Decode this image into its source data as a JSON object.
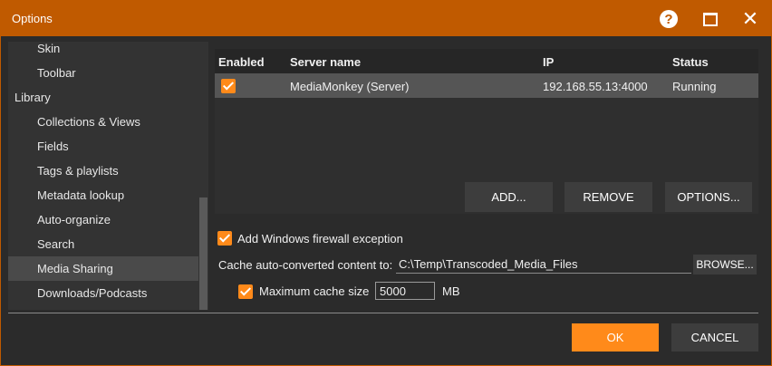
{
  "window": {
    "title": "Options"
  },
  "titlebar": {
    "help_icon": "question-circle-icon",
    "maximize_icon": "maximize-icon",
    "close_icon": "close-icon",
    "help_glyph": "?",
    "close_glyph": "✕"
  },
  "sidebar": {
    "items": [
      {
        "label": "Skin",
        "level": 1,
        "selected": false
      },
      {
        "label": "Toolbar",
        "level": 1,
        "selected": false
      },
      {
        "label": "Library",
        "level": 0,
        "selected": false
      },
      {
        "label": "Collections & Views",
        "level": 1,
        "selected": false
      },
      {
        "label": "Fields",
        "level": 1,
        "selected": false
      },
      {
        "label": "Tags & playlists",
        "level": 1,
        "selected": false
      },
      {
        "label": "Metadata lookup",
        "level": 1,
        "selected": false
      },
      {
        "label": "Auto-organize",
        "level": 1,
        "selected": false
      },
      {
        "label": "Search",
        "level": 1,
        "selected": false
      },
      {
        "label": "Media Sharing",
        "level": 1,
        "selected": true
      },
      {
        "label": "Downloads/Podcasts",
        "level": 1,
        "selected": false
      }
    ]
  },
  "servers": {
    "columns": [
      "Enabled",
      "Server name",
      "IP",
      "Status"
    ],
    "rows": [
      {
        "enabled": true,
        "name": "MediaMonkey (Server)",
        "ip": "192.168.55.13:4000",
        "status": "Running"
      }
    ]
  },
  "actions": {
    "add": "ADD...",
    "remove": "REMOVE",
    "options": "OPTIONS..."
  },
  "firewall": {
    "label": "Add Windows firewall exception",
    "checked": true
  },
  "cache": {
    "label": "Cache auto-converted content to:",
    "path": "C:\\Temp\\Transcoded_Media_Files",
    "browse": "BROWSE..."
  },
  "max_cache": {
    "label": "Maximum cache size",
    "checked": true,
    "value": "5000",
    "unit": "MB"
  },
  "footer": {
    "ok": "OK",
    "cancel": "CANCEL"
  },
  "colors": {
    "accent": "#ff8a1a",
    "titlebar": "#c05a00",
    "background": "#2b2b2b"
  }
}
